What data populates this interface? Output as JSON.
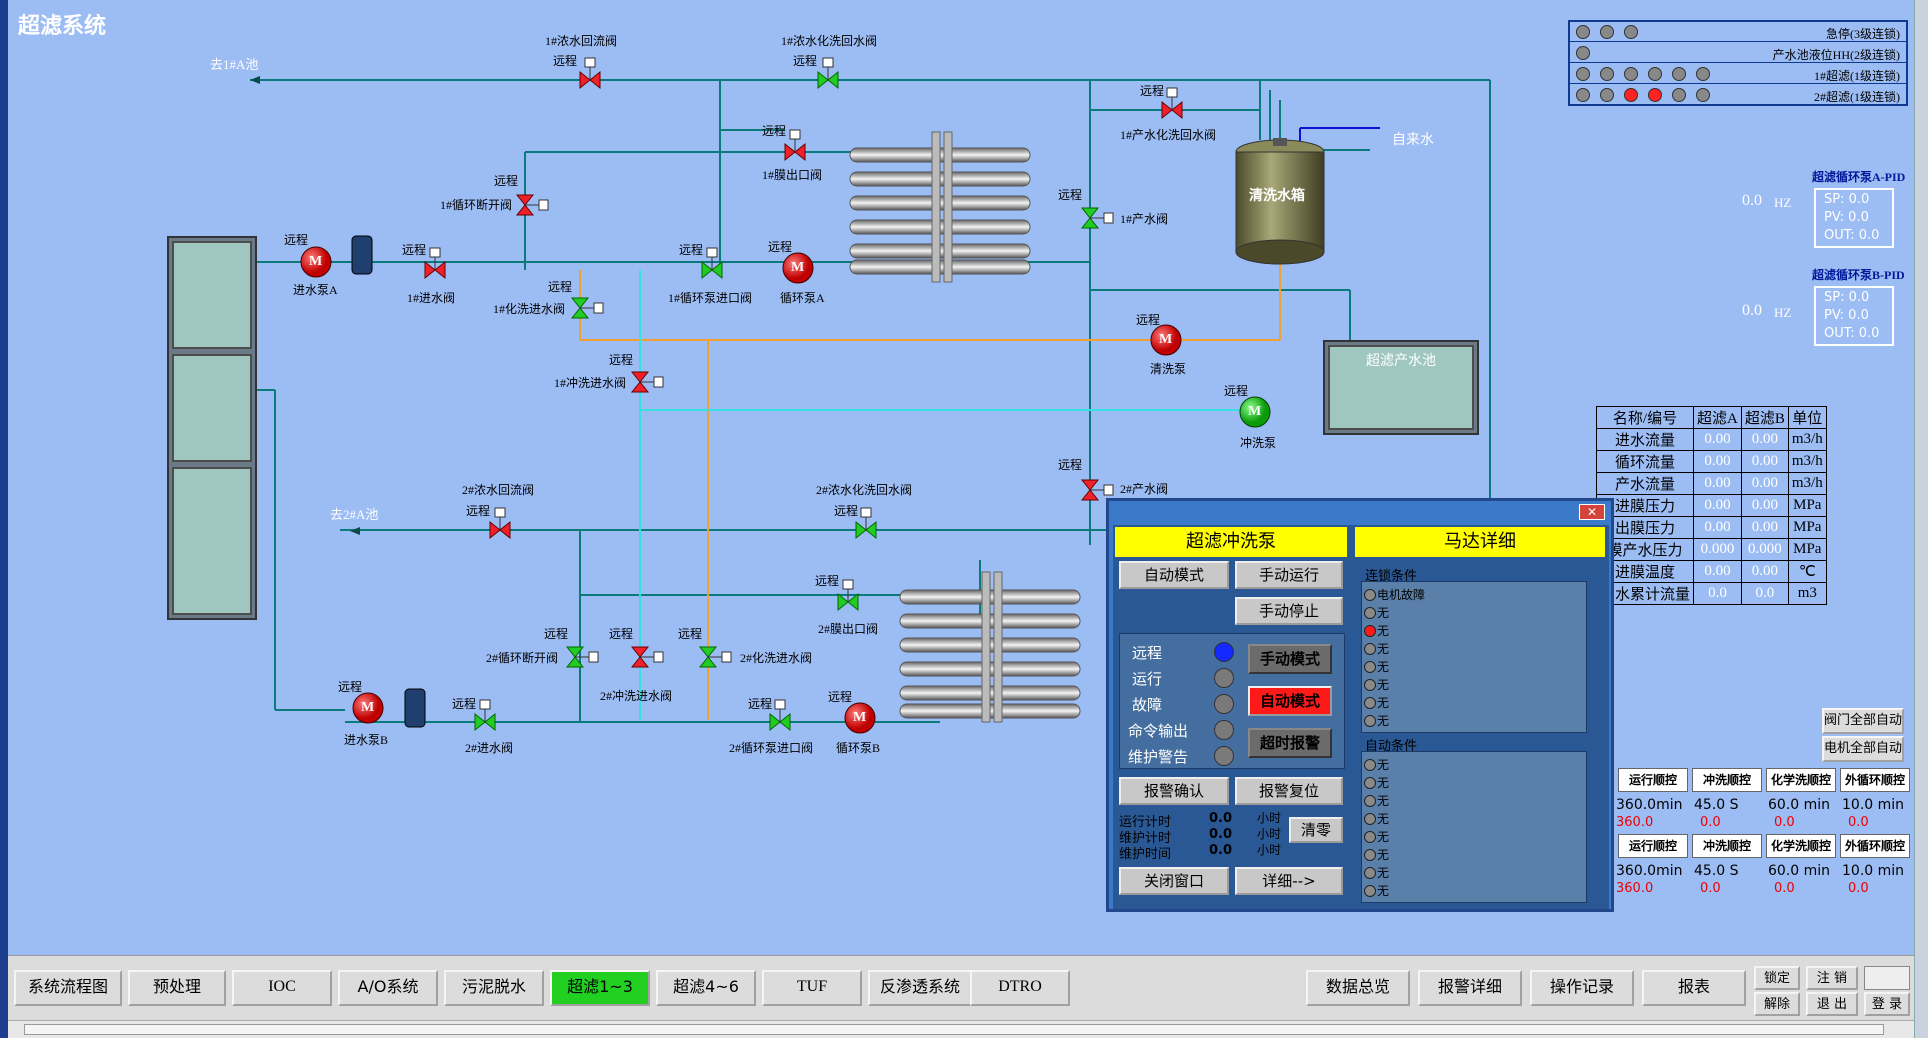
{
  "screen": {
    "title": "超滤系统"
  },
  "labels": {
    "to_1a": "去1#A池",
    "to_2a": "去2#A池",
    "remote": "远程",
    "v1_conc_return": "1#浓水回流阀",
    "v1_conc_chem_return": "1#浓水化洗回水阀",
    "v1_prod_chem_return": "1#产水化洗回水阀",
    "v1_membrane_out": "1#膜出口阀",
    "v1_loop_break": "1#循环断开阀",
    "v1_in": "1#进水阀",
    "v1_chem_in": "1#化洗进水阀",
    "v1_loop_pump_in": "1#循环泵进口阀",
    "v1_flush_in": "1#冲洗进水阀",
    "v1_prod": "1#产水阀",
    "pump_in_a": "进水泵A",
    "pump_loop_a": "循环泵A",
    "pump_clean": "清洗泵",
    "pump_flush": "冲洗泵",
    "tap_water": "自来水",
    "clean_tank": "清洗水箱",
    "uf_pool": "超滤产水池",
    "v2_conc_return": "2#浓水回流阀",
    "v2_conc_chem_return": "2#浓水化洗回水阀",
    "v2_prod": "2#产水阀",
    "v2_membrane_out": "2#膜出口阀",
    "v2_loop_break": "2#循环断开阀",
    "v2_flush_in": "2#冲洗进水阀",
    "v2_chem_in": "2#化洗进水阀",
    "v2_in": "2#进水阀",
    "v2_loop_pump_in": "2#循环泵进口阀",
    "pump_in_b": "进水泵B",
    "pump_loop_b": "循环泵B",
    "motor": "M"
  },
  "interlocks": [
    {
      "text": "急停(3级连锁)",
      "dots": [
        "grey",
        "grey",
        "grey"
      ]
    },
    {
      "text": "产水池液位HH(2级连锁)",
      "dots": [
        "grey"
      ]
    },
    {
      "text": "1#超滤(1级连锁)",
      "dots": [
        "grey",
        "grey",
        "grey",
        "grey",
        "grey",
        "grey"
      ]
    },
    {
      "text": "2#超滤(1级连锁)",
      "dots": [
        "grey",
        "grey",
        "red",
        "red",
        "grey",
        "grey"
      ]
    }
  ],
  "pid_a": {
    "title": "超滤循环泵A-PID",
    "freq": "0.0",
    "unit": "HZ",
    "sp": "SP:  0.0",
    "pv": "PV:  0.0",
    "out": "OUT:  0.0"
  },
  "pid_b": {
    "title": "超滤循环泵B-PID",
    "freq": "0.0",
    "unit": "HZ",
    "sp": "SP:  0.0",
    "pv": "PV:  0.0",
    "out": "OUT:  0.0"
  },
  "flow_table": {
    "headers": [
      "名称/编号",
      "超滤A",
      "超滤B",
      "单位"
    ],
    "rows": [
      [
        "进水流量",
        "0.00",
        "0.00",
        "m3/h"
      ],
      [
        "循环流量",
        "0.00",
        "0.00",
        "m3/h"
      ],
      [
        "产水流量",
        "0.00",
        "0.00",
        "m3/h"
      ],
      [
        "进膜压力",
        "0.00",
        "0.00",
        "MPa"
      ],
      [
        "出膜压力",
        "0.00",
        "0.00",
        "MPa"
      ],
      [
        "膜产水压力",
        "0.000",
        "0.000",
        "MPa"
      ],
      [
        "进膜温度",
        "0.00",
        "0.00",
        "℃"
      ],
      [
        "产水累计流量",
        "0.0",
        "0.0",
        "m3"
      ]
    ]
  },
  "side_buttons": {
    "valves_auto": "阀门全部自动",
    "motors_auto": "电机全部自动"
  },
  "sequences": [
    {
      "headers": [
        "运行顺控",
        "冲洗顺控",
        "化学洗顺控",
        "外循环顺控"
      ],
      "values": [
        "360.0min",
        "45.0  S",
        "60.0 min",
        "10.0 min"
      ],
      "remain": [
        "360.0",
        "0.0",
        "0.0",
        "0.0"
      ]
    },
    {
      "headers": [
        "运行顺控",
        "冲洗顺控",
        "化学洗顺控",
        "外循环顺控"
      ],
      "values": [
        "360.0min",
        "45.0  S",
        "60.0 min",
        "10.0 min"
      ],
      "remain": [
        "360.0",
        "0.0",
        "0.0",
        "0.0"
      ]
    }
  ],
  "popup": {
    "title_left": "超滤冲洗泵",
    "title_right": "马达详细",
    "auto_mode": "自动模式",
    "manual_run": "手动运行",
    "manual_stop": "手动停止",
    "status": [
      "远程",
      "运行",
      "故障",
      "命令输出",
      "维护警告"
    ],
    "mode_manual": "手动模式",
    "mode_auto": "自动模式",
    "timeout_alarm": "超时报警",
    "ack": "报警确认",
    "reset": "报警复位",
    "t_run": "运行计时",
    "t_maint": "维护计时",
    "t_maint_time": "维护时间",
    "t_run_val": "0.0",
    "t_maint_val": "0.0",
    "t_maint_time_val": "0.0",
    "hour": "小时",
    "clear": "清零",
    "close": "关闭窗口",
    "detail": "详细-->",
    "interlock_title": "连锁条件",
    "auto_title": "自动条件",
    "interlock_items": [
      "电机故障",
      "无",
      "无",
      "无",
      "无",
      "无",
      "无",
      "无"
    ],
    "auto_items": [
      "无",
      "无",
      "无",
      "无",
      "无",
      "无",
      "无",
      "无"
    ]
  },
  "nav": {
    "tabs": [
      "系统流程图",
      "预处理",
      "IOC",
      "A/O系统",
      "污泥脱水",
      "超滤1~3",
      "超滤4~6",
      "TUF",
      "反渗透系统",
      "DTRO"
    ],
    "active": "超滤1~3",
    "right": [
      "数据总览",
      "报警详细",
      "操作记录",
      "报表"
    ],
    "lock": "锁定",
    "unlock": "解除",
    "logout": "注 销",
    "exit": "退 出",
    "login": "登 录"
  },
  "colors": {
    "background": "#9cbcf4",
    "pipe": "#0a7a7a",
    "pipe_orange": "#f0a030",
    "pipe_cyan": "#39e0e0",
    "valve_red": "#f0202a",
    "valve_green": "#22cc22"
  }
}
